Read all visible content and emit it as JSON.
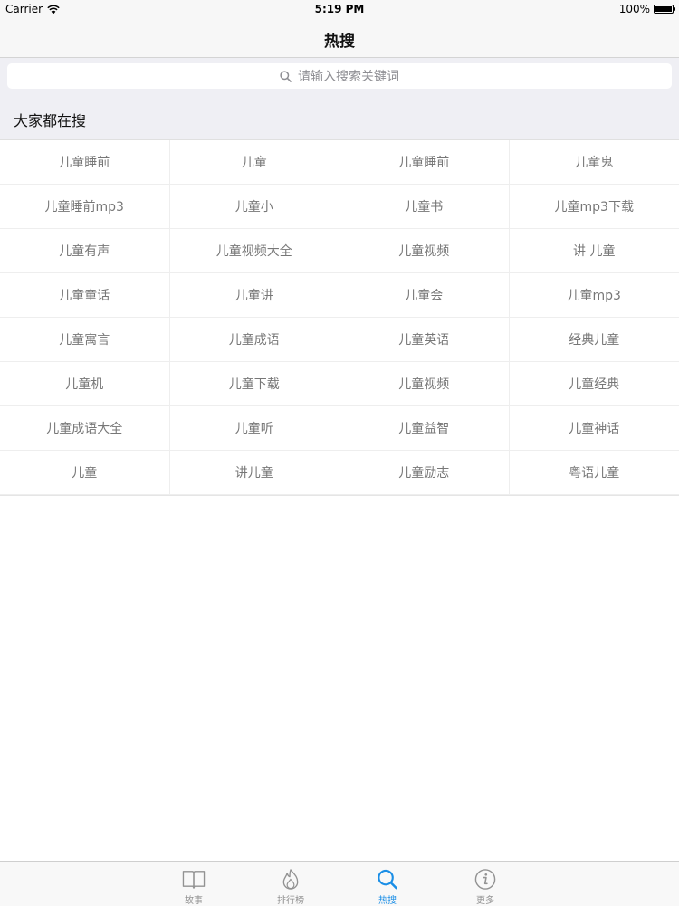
{
  "status_bar": {
    "carrier": "Carrier",
    "time": "5:19 PM",
    "battery": "100%",
    "battery_level": 1.0
  },
  "nav": {
    "title": "热搜"
  },
  "search": {
    "placeholder": "请输入搜索关键词",
    "icon": "search-icon"
  },
  "section": {
    "title": "大家都在搜"
  },
  "keywords": [
    "儿童睡前",
    "儿童",
    "儿童睡前",
    "儿童鬼",
    "儿童睡前mp3",
    "儿童小",
    "儿童书",
    "儿童mp3下载",
    "儿童有声",
    "儿童视频大全",
    "儿童视频",
    "讲 儿童",
    "儿童童话",
    "儿童讲",
    "儿童会",
    "儿童mp3",
    "儿童寓言",
    "儿童成语",
    "儿童英语",
    "经典儿童",
    "儿童机",
    "儿童下载",
    "儿童视频",
    "儿童经典",
    "儿童成语大全",
    "儿童听",
    "儿童益智",
    "儿童神话",
    "儿童",
    "讲儿童",
    "儿童励志",
    "粤语儿童"
  ],
  "tabs": [
    {
      "label": "故事",
      "icon": "book-icon",
      "active": false
    },
    {
      "label": "排行榜",
      "icon": "flame-icon",
      "active": false
    },
    {
      "label": "热搜",
      "icon": "search-icon",
      "active": true
    },
    {
      "label": "更多",
      "icon": "info-icon",
      "active": false
    }
  ],
  "colors": {
    "accent": "#1a8ee6",
    "tab_inactive": "#929292",
    "keyword_text": "#777777",
    "section_bg": "#efeff4"
  }
}
